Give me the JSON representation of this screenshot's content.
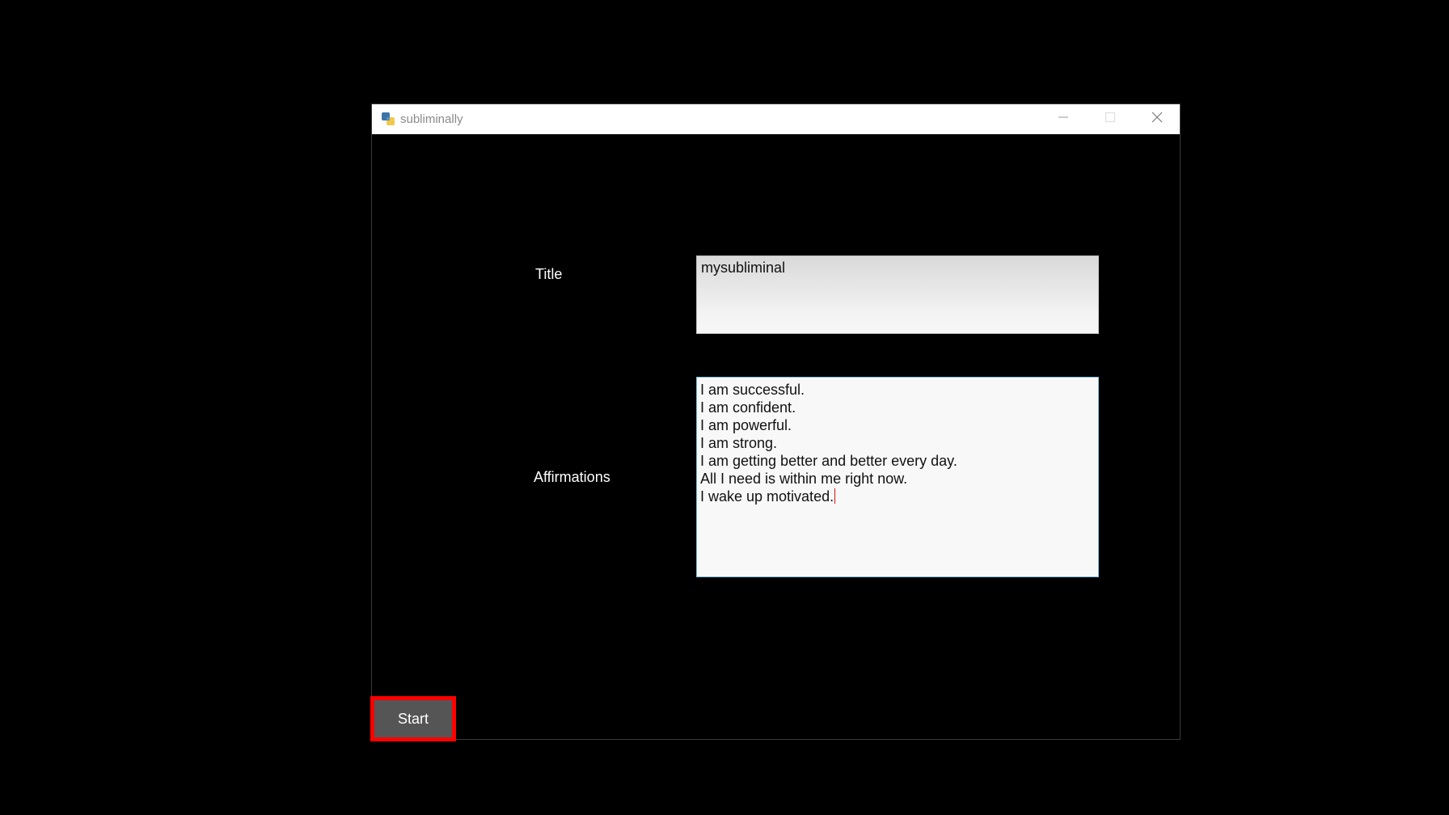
{
  "window": {
    "title": "subliminally"
  },
  "form": {
    "title_label": "Title",
    "title_value": "mysubliminal",
    "affirmations_label": "Affirmations",
    "affirmations_lines": [
      "I am successful.",
      "I am confident.",
      "I am powerful.",
      "I am strong.",
      "I am getting better and better every day.",
      "All I need is within me right now.",
      "I wake up motivated."
    ]
  },
  "actions": {
    "start_label": "Start"
  },
  "colors": {
    "background": "#000000",
    "button_bg": "#555555",
    "highlight": "#ff0000",
    "text_area_border": "#7ab8d9"
  },
  "icons": {
    "app": "python-icon",
    "minimize": "minimize-icon",
    "maximize": "maximize-icon",
    "close": "close-icon"
  }
}
